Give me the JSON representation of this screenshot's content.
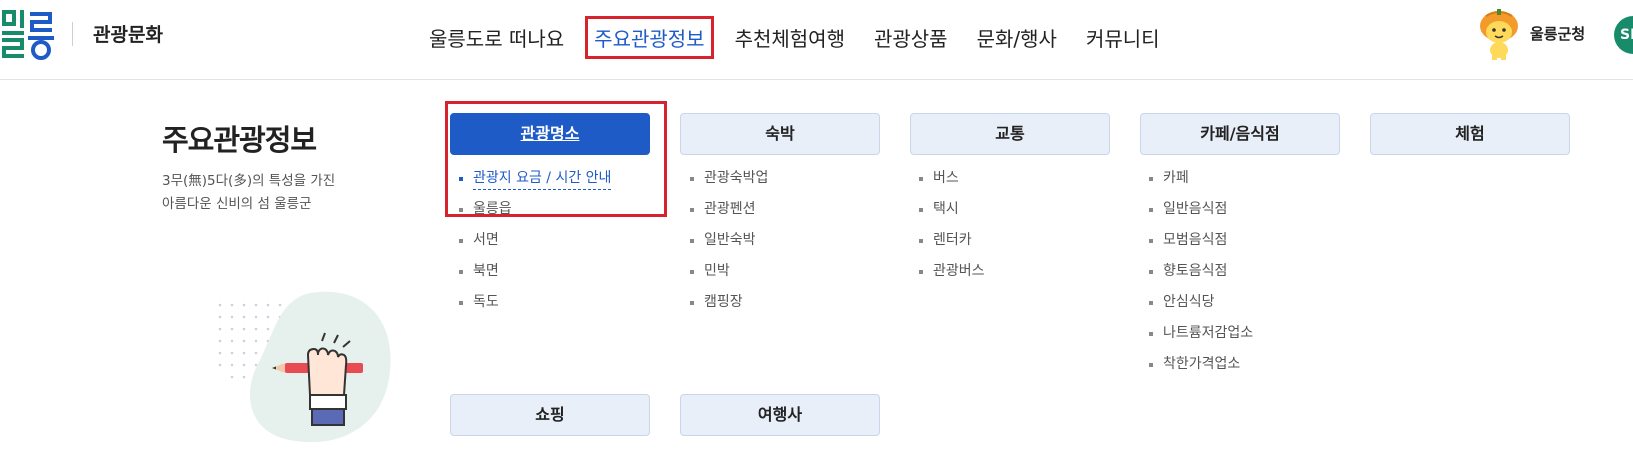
{
  "header": {
    "logo_icon": "ulleung-logo-icon",
    "brand": "관광문화",
    "nav": [
      "울릉도로 떠나요",
      "주요관광정보",
      "추천체험여행",
      "관광상품",
      "문화/행사",
      "커뮤니티"
    ],
    "active_nav": "주요관광정보",
    "mascot_icon": "pumpkin-mascot-icon",
    "gov_link": "울릉군청",
    "avatar_text": "SI"
  },
  "intro": {
    "title": "주요관광정보",
    "desc_line1": "3무(無)5다(多)의 특성을 가진",
    "desc_line2": "아름다운 신비의 섬 울릉군",
    "illustration_icon": "hand-holding-pencil-icon"
  },
  "menu": {
    "categories": [
      {
        "label": "관광명소",
        "items": [
          "관광지 요금 / 시간 안내",
          "울릉읍",
          "서면",
          "북면",
          "독도"
        ]
      },
      {
        "label": "숙박",
        "items": [
          "관광숙박업",
          "관광펜션",
          "일반숙박",
          "민박",
          "캠핑장"
        ]
      },
      {
        "label": "교통",
        "items": [
          "버스",
          "택시",
          "렌터카",
          "관광버스"
        ]
      },
      {
        "label": "카페/음식점",
        "items": [
          "카페",
          "일반음식점",
          "모범음식점",
          "향토음식점",
          "안심식당",
          "나트륨저감업소",
          "착한가격업소"
        ]
      },
      {
        "label": "체험",
        "items": []
      },
      {
        "label": "쇼핑",
        "items": []
      },
      {
        "label": "여행사",
        "items": []
      }
    ],
    "active_category": "관광명소",
    "hovered_item": "관광지 요금 / 시간 안내"
  },
  "colors": {
    "accent": "#1f5bc7",
    "highlight_border": "#d6232d",
    "logo_green": "#178b6a",
    "logo_blue": "#1f5bc7",
    "category_bg": "#e9eff8"
  }
}
